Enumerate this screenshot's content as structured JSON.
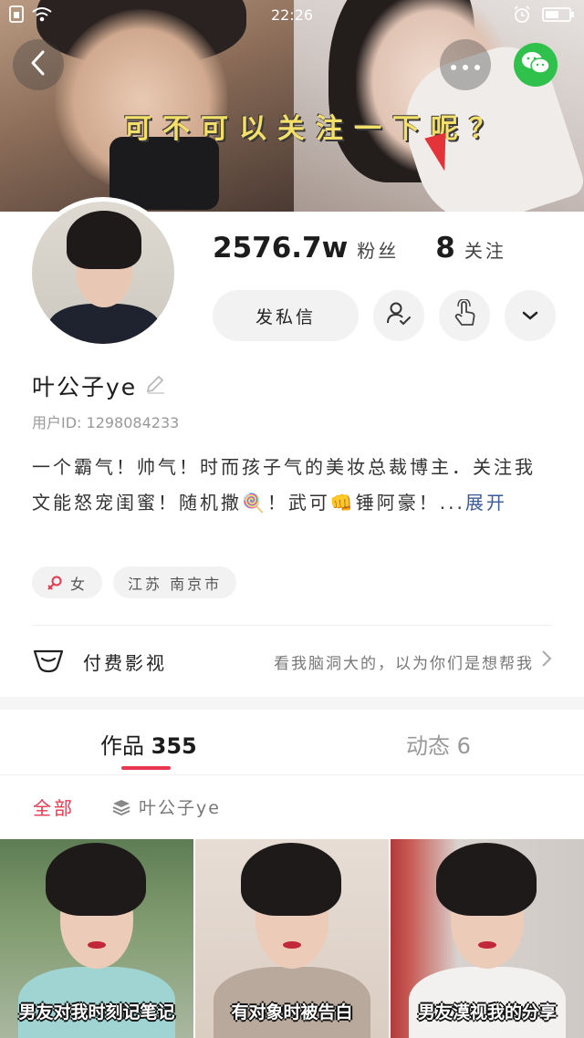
{
  "status_bar": {
    "time": "22:26"
  },
  "banner": {
    "caption": "可不可以关注一下呢？"
  },
  "profile": {
    "fans_count": "2576.7w",
    "fans_label": "粉丝",
    "following_count": "8",
    "following_label": "关注",
    "message_button": "发私信",
    "name": "叶公子ye",
    "user_id": "用户ID: 1298084233",
    "bio_line1": "一个霸气！帅气！时而孩子气的美妆总裁博主．关注我",
    "bio_line2": "文能怒宠闺蜜！随机撒🍭！武可👊锤阿豪！...",
    "bio_expand": "展开",
    "tags": [
      {
        "icon": "female-icon",
        "label": "女"
      },
      {
        "label": "江苏 南京市"
      }
    ]
  },
  "paid_video": {
    "title": "付费影视",
    "description": "看我脑洞大的，以为你们是想帮我"
  },
  "tabs": [
    {
      "label": "作品",
      "count": "355",
      "active": true
    },
    {
      "label": "动态",
      "count": "6",
      "active": false
    }
  ],
  "filters": {
    "all": "全部",
    "collection": "叶公子ye"
  },
  "videos": [
    {
      "caption": "男友对我时刻记笔记"
    },
    {
      "caption": "有对象时被告白"
    },
    {
      "caption": "男友漠视我的分享"
    }
  ],
  "colors": {
    "accent": "#e8384f",
    "wechat": "#2fc14b",
    "link": "#3a5a98",
    "banner_caption": "#f4df6a"
  }
}
